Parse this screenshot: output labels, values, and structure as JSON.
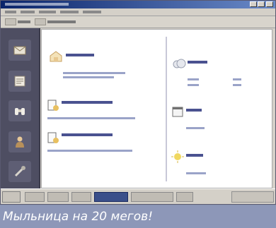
{
  "caption": {
    "text": "Мыльница на 20 мегов!"
  },
  "colors": {
    "titlebar": "#0a246a",
    "sidebar": "#4e4e62",
    "caption_bg": "#8d97b8",
    "link_text": "#4a5290"
  },
  "sidebar": {
    "items": [
      {
        "icon": "mail-icon"
      },
      {
        "icon": "news-icon"
      },
      {
        "icon": "binoculars-icon"
      },
      {
        "icon": "user-icon"
      },
      {
        "icon": "tools-icon"
      }
    ]
  }
}
